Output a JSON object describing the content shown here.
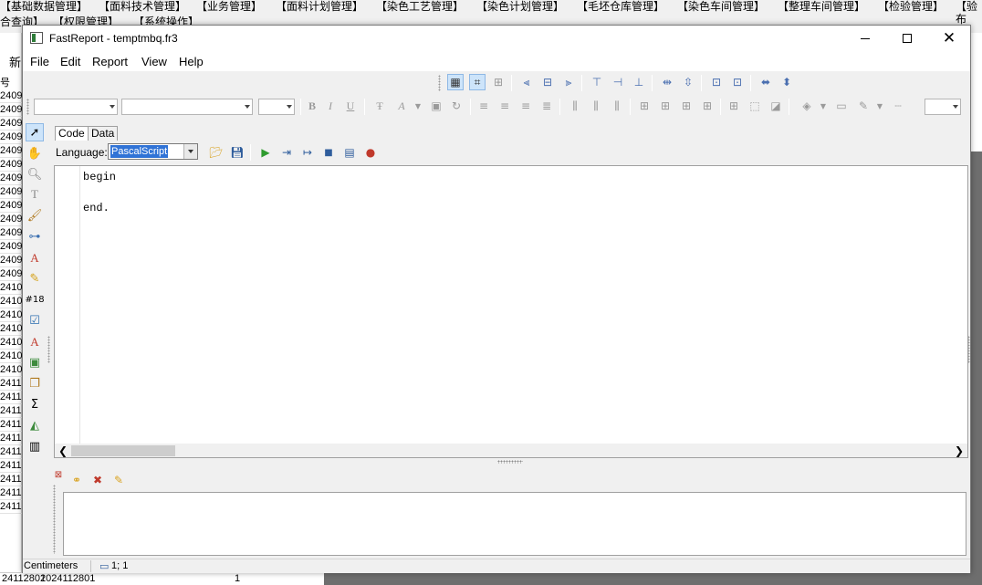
{
  "background_app": {
    "menu_row1": [
      "【基础数据管理】",
      "【面料技术管理】",
      "【业务管理】",
      "【面料计划管理】",
      "【染色工艺管理】",
      "【染色计划管理】",
      "【毛坯仓库管理】",
      "【染色车间管理】",
      "【整理车间管理】",
      "【检验管理】",
      "【验布"
    ],
    "menu_row2": [
      "合查询】",
      "【权限管理】",
      "【系统操作】"
    ],
    "new_button": "新",
    "column_header": "号",
    "row_ids": [
      "2409",
      "2409",
      "2409",
      "2409",
      "2409",
      "2409",
      "2409",
      "2409",
      "2409",
      "2409",
      "2409",
      "2409",
      "2409",
      "2409",
      "2410",
      "2410",
      "2410",
      "2410",
      "2410",
      "2410",
      "2410",
      "2411",
      "2411",
      "2411",
      "2411",
      "2411",
      "2411",
      "2411",
      "2411",
      "2411",
      "2411"
    ],
    "bottom_row": {
      "col1": "24112801",
      "col2": "2024112801",
      "col3": "1"
    }
  },
  "window": {
    "title": "FastReport - temptmbq.fr3",
    "minimize_glyph": "—",
    "close_glyph": "✕"
  },
  "menu": [
    "File",
    "Edit",
    "Report",
    "View",
    "Help"
  ],
  "tabs": {
    "code": "Code",
    "data": "Data"
  },
  "language_bar": {
    "label": "Language:",
    "selected": "PascalScript"
  },
  "editor": {
    "lines": [
      "begin",
      "",
      "end."
    ]
  },
  "statusbar": {
    "units": "Centimeters",
    "cursor": "1; 1"
  }
}
